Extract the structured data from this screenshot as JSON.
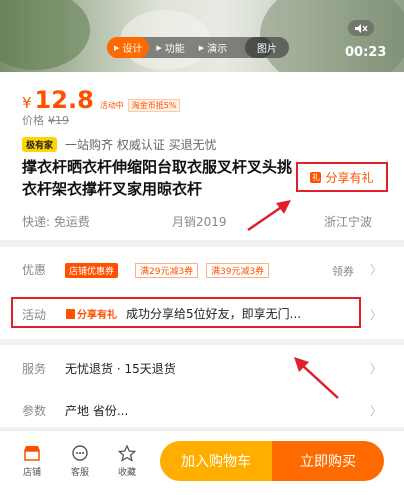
{
  "media": {
    "tabs": [
      {
        "label": "设计",
        "active": true
      },
      {
        "label": "功能",
        "active": false
      },
      {
        "label": "演示",
        "active": false
      }
    ],
    "picture_tab": "图片",
    "duration": "00:23",
    "mute_icon": "speaker-mute-icon"
  },
  "product": {
    "currency": "¥",
    "price": "12.8",
    "activity_tag": "活动中",
    "coin_tag": "淘金币抵5%",
    "orig_label": "价格",
    "orig_price": "¥19",
    "badge": "极有家",
    "features": "一站购齐 权威认证 买退无忧",
    "title": "撑衣杆晒衣杆伸缩阳台取衣服叉杆叉头挑衣杆架衣撑杆叉家用晾衣杆",
    "share_label": "分享有礼",
    "shipping": "快递: 免运费",
    "monthly_sales": "月销2019",
    "location": "浙江宁波"
  },
  "promotions": {
    "label": "优惠",
    "shop_coupon": "店铺优惠券",
    "coupons": [
      "满29元减3券",
      "满39元减3券"
    ],
    "get_coupon": "领券",
    "activity_label": "活动",
    "activity_tag": "分享有礼",
    "activity_text": "成功分享给5位好友，即享无门..."
  },
  "service": {
    "label": "服务",
    "value": "无忧退货 · 15天退货",
    "params_label": "参数",
    "params_value": "产地 省份..."
  },
  "bottom_bar": {
    "shop": "店铺",
    "service": "客服",
    "favorite": "收藏",
    "add_to_cart": "加入购物车",
    "buy_now": "立即购买"
  },
  "colors": {
    "accent": "#ff5000",
    "highlight_box": "#e0202a",
    "cart": "#ffae00",
    "buy": "#ff6a00",
    "badge": "#ffd400"
  }
}
